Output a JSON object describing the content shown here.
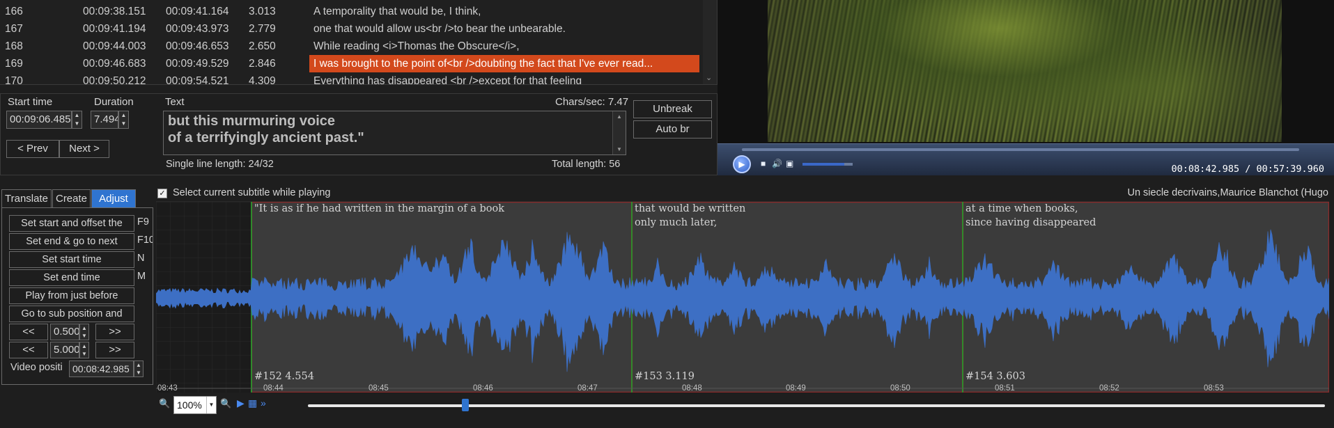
{
  "grid": {
    "rows": [
      {
        "num": "166",
        "start": "00:09:38.151",
        "end": "00:09:41.164",
        "dur": "3.013",
        "text": "A temporality that would be, I think,",
        "selected": false
      },
      {
        "num": "167",
        "start": "00:09:41.194",
        "end": "00:09:43.973",
        "dur": "2.779",
        "text": "one that would allow us<br />to bear the unbearable.",
        "selected": false
      },
      {
        "num": "168",
        "start": "00:09:44.003",
        "end": "00:09:46.653",
        "dur": "2.650",
        "text": "While reading <i>Thomas the Obscure</i>,",
        "selected": false
      },
      {
        "num": "169",
        "start": "00:09:46.683",
        "end": "00:09:49.529",
        "dur": "2.846",
        "text": "I was brought to the point of<br />doubting the fact that I've ever read...",
        "selected": true
      },
      {
        "num": "170",
        "start": "00:09:50.212",
        "end": "00:09:54.521",
        "dur": "4.309",
        "text": "Everything has disappeared <br />except for that feeling",
        "selected": false
      }
    ]
  },
  "edit": {
    "start_label": "Start time",
    "start_value": "00:09:06.485",
    "duration_label": "Duration",
    "duration_value": "7.494",
    "text_label": "Text",
    "chars_sec": "Chars/sec: 7.47",
    "text_value": "but this murmuring voice\nof a terrifyingly ancient past.\"",
    "single_line": "Single line length: 24/32",
    "total_length": "Total length: 56",
    "prev_label": "< Prev",
    "next_label": "Next >",
    "unbreak_label": "Unbreak",
    "autobr_label": "Auto br"
  },
  "video": {
    "time": "00:08:42.985 / 00:57:39.960",
    "volume_percent": 83,
    "play_icon": "play-icon",
    "stop_icon": "stop-icon",
    "mute_icon": "speaker-icon",
    "fullscreen_icon": "fullscreen-icon"
  },
  "tabs": {
    "translate": "Translate",
    "create": "Create",
    "adjust": "Adjust"
  },
  "adjust": {
    "buttons": [
      {
        "label": "Set start and offset the",
        "key": "F9"
      },
      {
        "label": "Set end & go to next",
        "key": "F10"
      },
      {
        "label": "Set start time",
        "key": "N"
      },
      {
        "label": "Set end time",
        "key": "M"
      },
      {
        "label": "Play from just before",
        "key": ""
      },
      {
        "label": "Go to sub position and",
        "key": ""
      }
    ],
    "step1": "0.500",
    "step2": "5.000",
    "back_label": "<<",
    "fwd_label": ">>",
    "video_pos_label": "Video positi",
    "video_pos_value": "00:08:42.985"
  },
  "waveform": {
    "select_label": "Select current subtitle while playing",
    "title": "Un siecle decrivains,Maurice Blanchot  (Hugo",
    "segments": [
      {
        "text": "\"It is as if he had written in the margin of a book",
        "num": "#152  4.554"
      },
      {
        "text": "that would be written\nonly much later,",
        "num": "#153  3.119"
      },
      {
        "text": "at a time when books,\nsince having disappeared",
        "num": "#154  3.603"
      }
    ],
    "ticks": [
      "08:43",
      "08:44",
      "08:45",
      "08:46",
      "08:47",
      "08:48",
      "08:49",
      "08:50",
      "08:51",
      "08:52",
      "08:53"
    ]
  },
  "zoom": {
    "value": "100%",
    "position_fraction": 0.155
  }
}
